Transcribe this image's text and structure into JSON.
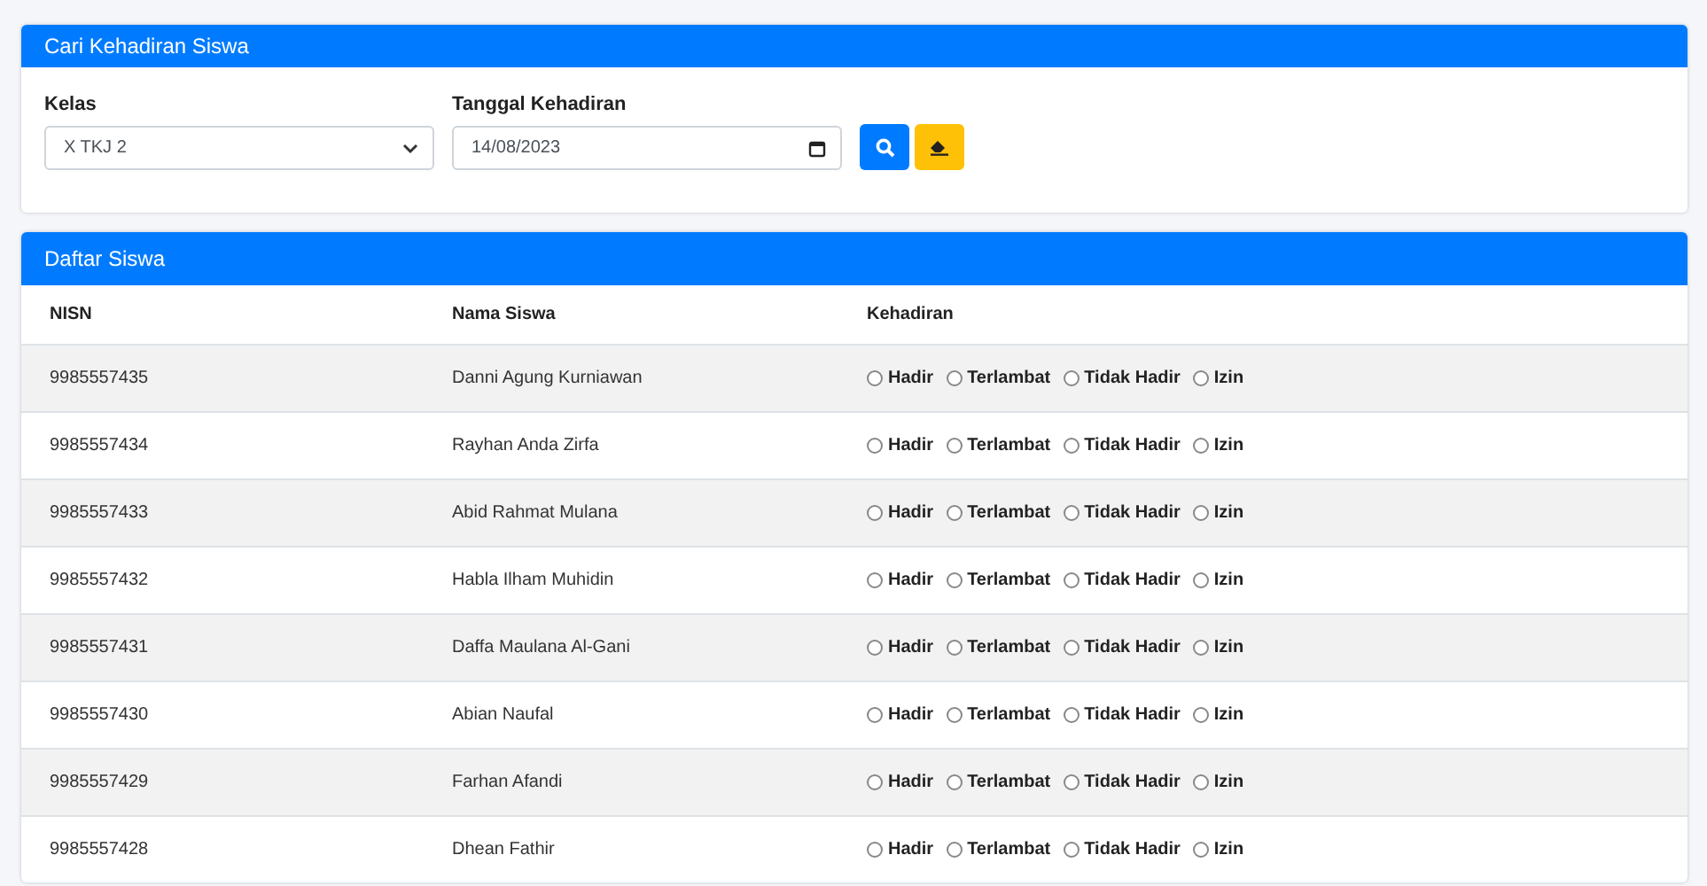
{
  "search_card": {
    "title": "Cari Kehadiran Siswa",
    "class_field": {
      "label": "Kelas",
      "value": "X TKJ 2"
    },
    "date_field": {
      "label": "Tanggal Kehadiran",
      "value": "14/08/2023"
    }
  },
  "student_card": {
    "title": "Daftar Siswa",
    "columns": [
      "NISN",
      "Nama Siswa",
      "Kehadiran"
    ],
    "rows": [
      {
        "nisn": "9985557435",
        "name": "Danni Agung Kurniawan",
        "options": [
          {
            "label": "Hadir",
            "selected": false
          },
          {
            "label": "Terlambat",
            "selected": false
          },
          {
            "label": "Tidak Hadir",
            "selected": false
          },
          {
            "label": "Izin",
            "selected": false
          }
        ]
      },
      {
        "nisn": "9985557434",
        "name": "Rayhan Anda Zirfa",
        "options": [
          {
            "label": "Hadir",
            "selected": false
          },
          {
            "label": "Terlambat",
            "selected": false
          },
          {
            "label": "Tidak Hadir",
            "selected": false
          },
          {
            "label": "Izin",
            "selected": false
          }
        ]
      },
      {
        "nisn": "9985557433",
        "name": "Abid Rahmat Mulana",
        "options": [
          {
            "label": "Hadir",
            "selected": false
          },
          {
            "label": "Terlambat",
            "selected": false
          },
          {
            "label": "Tidak Hadir",
            "selected": false
          },
          {
            "label": "Izin",
            "selected": false
          }
        ]
      },
      {
        "nisn": "9985557432",
        "name": "Habla Ilham Muhidin",
        "options": [
          {
            "label": "Hadir",
            "selected": false
          },
          {
            "label": "Terlambat",
            "selected": false
          },
          {
            "label": "Tidak Hadir",
            "selected": false
          },
          {
            "label": "Izin",
            "selected": false
          }
        ]
      },
      {
        "nisn": "9985557431",
        "name": "Daffa Maulana Al-Gani",
        "options": [
          {
            "label": "Hadir",
            "selected": false
          },
          {
            "label": "Terlambat",
            "selected": false
          },
          {
            "label": "Tidak Hadir",
            "selected": false
          },
          {
            "label": "Izin",
            "selected": false
          }
        ]
      },
      {
        "nisn": "9985557430",
        "name": "Abian Naufal",
        "options": [
          {
            "label": "Hadir",
            "selected": false
          },
          {
            "label": "Terlambat",
            "selected": false
          },
          {
            "label": "Tidak Hadir",
            "selected": false
          },
          {
            "label": "Izin",
            "selected": false
          }
        ]
      },
      {
        "nisn": "9985557429",
        "name": "Farhan Afandi",
        "options": [
          {
            "label": "Hadir",
            "selected": false
          },
          {
            "label": "Terlambat",
            "selected": false
          },
          {
            "label": "Tidak Hadir",
            "selected": false
          },
          {
            "label": "Izin",
            "selected": false
          }
        ]
      },
      {
        "nisn": "9985557428",
        "name": "Dhean Fathir",
        "options": [
          {
            "label": "Hadir",
            "selected": false
          },
          {
            "label": "Terlambat",
            "selected": false
          },
          {
            "label": "Tidak Hadir",
            "selected": false
          },
          {
            "label": "Izin",
            "selected": false
          }
        ]
      }
    ]
  }
}
